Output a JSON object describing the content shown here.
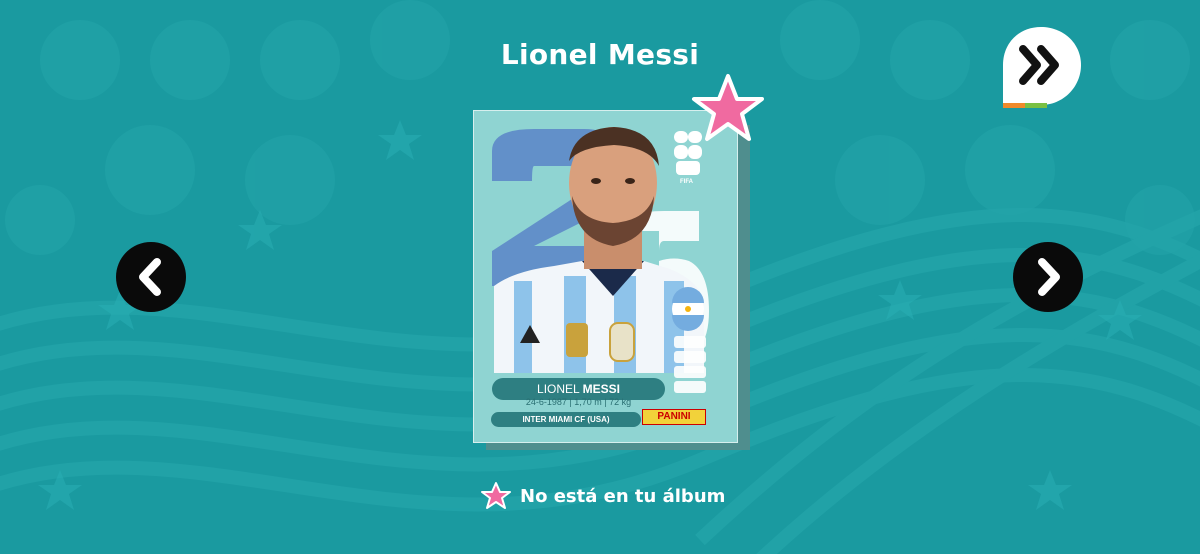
{
  "player": {
    "name": "Lionel Messi"
  },
  "sticker": {
    "first_name": "LIONEL",
    "last_name": "MESSI",
    "stats": "24-6-1987 | 1,70 m | 72 kg",
    "club": "INTER MIAMI CF (USA)",
    "brand": "PANINI",
    "fifa_label": "FIFA",
    "number_graphic": "26",
    "country_vertical": "ARG",
    "flag": "argentina-flag-icon"
  },
  "status": {
    "text": "No está en tu álbum",
    "icon": "pink-star-icon"
  },
  "navigation": {
    "prev_icon": "chevron-left-icon",
    "next_icon": "chevron-right-icon",
    "skip_icon": "double-chevron-right-icon"
  },
  "colors": {
    "background": "#1a9aa0",
    "star": "#f06aa0",
    "sticker_bg": "#8fd4d2",
    "label_bar": "#2e7f82"
  }
}
